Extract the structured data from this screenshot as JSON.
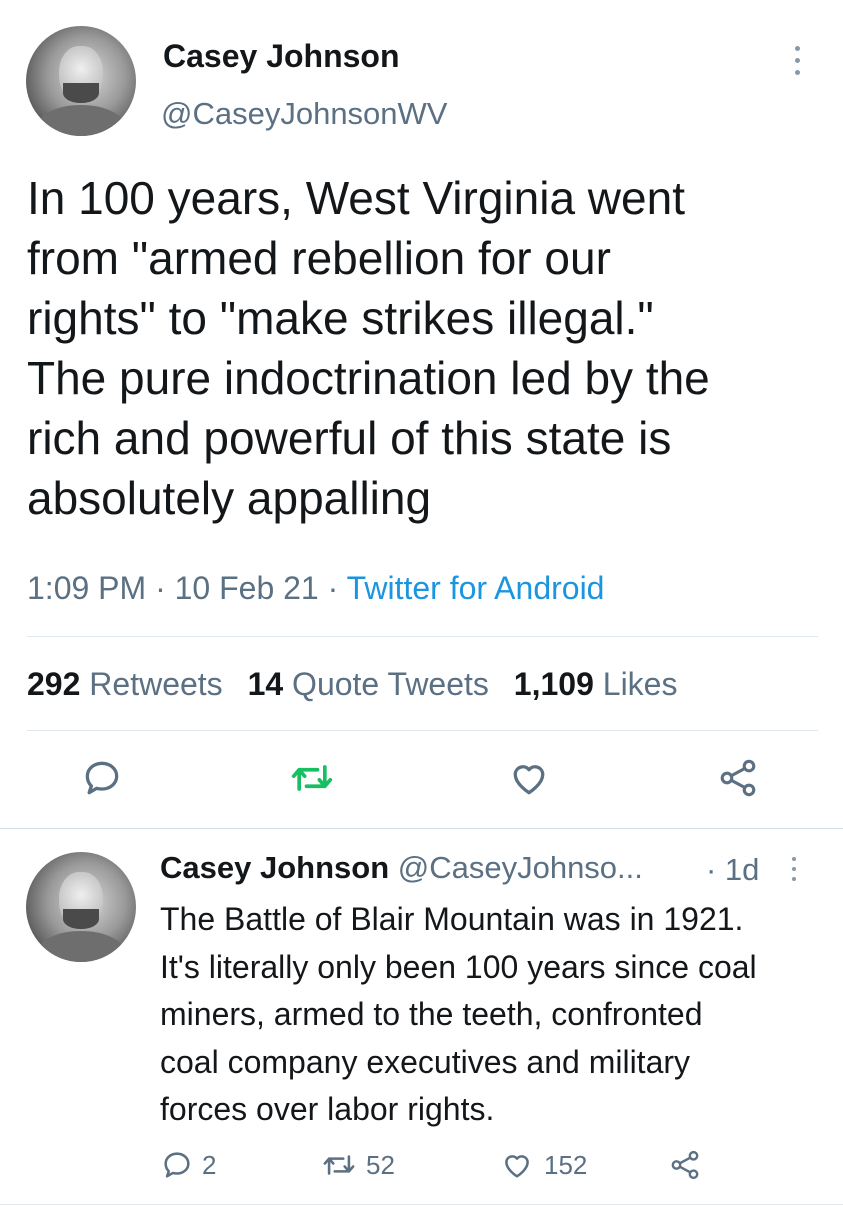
{
  "main_tweet": {
    "author_name": "Casey Johnson",
    "author_handle": "@CaseyJohnsonWV",
    "text_lines": [
      "In 100 years, West Virginia went",
      "from \"armed rebellion for our",
      "rights\" to \"make strikes illegal.\"",
      "The pure indoctrination led by the",
      "rich and powerful of this state is",
      "absolutely appalling"
    ],
    "time": "1:09 PM",
    "date": "10 Feb 21",
    "source": "Twitter for Android",
    "separator": "·",
    "stats": {
      "retweets_count": "292",
      "retweets_label": "Retweets",
      "quotes_count": "14",
      "quotes_label": "Quote Tweets",
      "likes_count": "1,109",
      "likes_label": "Likes"
    },
    "icons": [
      "reply-icon",
      "retweet-icon",
      "like-icon",
      "share-icon"
    ],
    "retweet_active_color": "#17bf63"
  },
  "reply_tweet": {
    "author_name": "Casey Johnson",
    "author_handle": "@CaseyJohnso...",
    "age": "· 1d",
    "text_lines": [
      "The Battle of Blair Mountain was in 1921.",
      "It's literally only been 100 years since coal",
      "miners, armed to the teeth, confronted",
      "coal company executives and military",
      "forces over labor rights."
    ],
    "reply_count": "2",
    "retweet_count": "52",
    "like_count": "152"
  },
  "colors": {
    "text": "#14171a",
    "muted": "#5b7083",
    "link": "#1b95e0",
    "divider": "#e1e8ed",
    "icon": "#5b7083"
  }
}
